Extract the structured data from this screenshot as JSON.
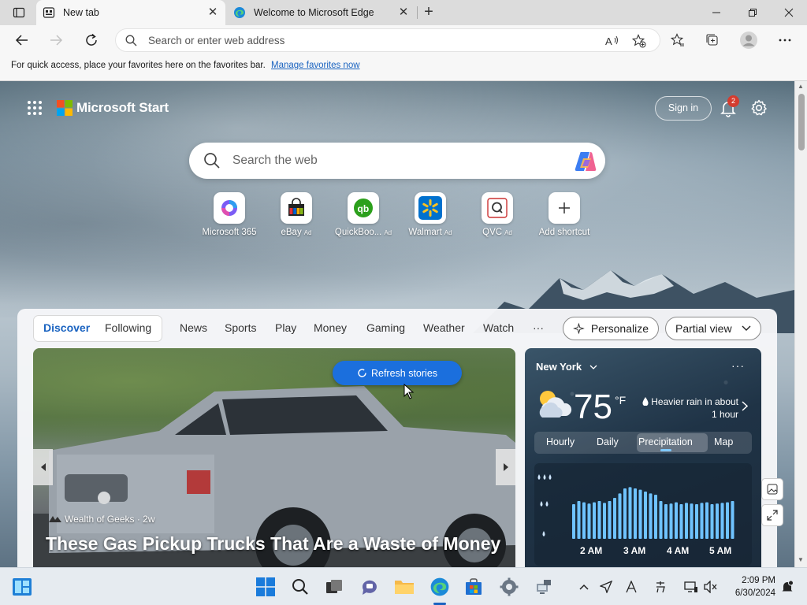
{
  "browser": {
    "tabs": [
      {
        "label": "New tab",
        "active": true
      },
      {
        "label": "Welcome to Microsoft Edge",
        "active": false
      }
    ],
    "address_placeholder": "Search or enter web address",
    "favorites_bar": {
      "message": "For quick access, place your favorites here on the favorites bar.",
      "link": "Manage favorites now"
    }
  },
  "header": {
    "brand": "Microsoft Start",
    "sign_in": "Sign in",
    "notification_count": "2"
  },
  "search": {
    "placeholder": "Search the web"
  },
  "shortcuts": [
    {
      "label": "Microsoft 365",
      "ad": ""
    },
    {
      "label": "eBay",
      "ad": "Ad"
    },
    {
      "label": "QuickBoo...",
      "ad": "Ad"
    },
    {
      "label": "Walmart",
      "ad": "Ad"
    },
    {
      "label": "QVC",
      "ad": "Ad"
    },
    {
      "label": "Add shortcut",
      "ad": ""
    }
  ],
  "feed": {
    "pivots": [
      "Discover",
      "Following"
    ],
    "categories": [
      "News",
      "Sports",
      "Play",
      "Money",
      "Gaming",
      "Weather",
      "Watch"
    ],
    "more": "···",
    "personalize": "Personalize",
    "view_mode": "Partial view",
    "refresh": "Refresh stories",
    "hero": {
      "source": "Wealth of Geeks · 2w",
      "headline": "These Gas Pickup Trucks That Are a Waste of Money"
    }
  },
  "weather": {
    "location": "New York",
    "more": "···",
    "temperature": "75",
    "unit": "°F",
    "description": "Heavier rain in about 1 hour",
    "tabs": [
      "Hourly",
      "Daily",
      "Precipitation",
      "Map"
    ],
    "selected_tab": "Precipitation",
    "hours": [
      "2 AM",
      "3 AM",
      "4 AM",
      "5 AM"
    ],
    "precip_bars": [
      0.55,
      0.6,
      0.58,
      0.56,
      0.58,
      0.6,
      0.57,
      0.6,
      0.65,
      0.72,
      0.8,
      0.82,
      0.8,
      0.78,
      0.75,
      0.72,
      0.7,
      0.6,
      0.55,
      0.56,
      0.58,
      0.55,
      0.57,
      0.56,
      0.55,
      0.57,
      0.58,
      0.55,
      0.56,
      0.57,
      0.58,
      0.6
    ]
  },
  "taskbar": {
    "time": "2:09 PM",
    "date": "6/30/2024"
  },
  "colors": {
    "accent": "#1a63c0",
    "refresh_button": "#1b6fdd",
    "notification_badge": "#d43c2f",
    "precip_bar": "#6fc3ff"
  }
}
